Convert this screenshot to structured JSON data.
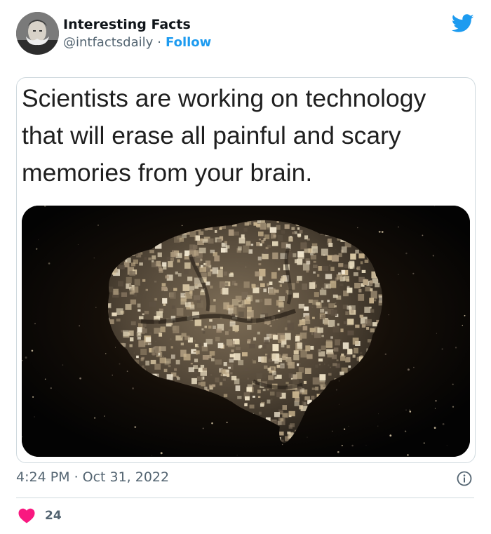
{
  "tweet": {
    "author": {
      "display_name": "Interesting Facts",
      "handle": "@intfactsdaily",
      "separator": "·",
      "follow_label": "Follow",
      "avatar_icon": "portrait-avatar-icon"
    },
    "brand_icon": "twitter-bird-icon",
    "brand_color": "#1d9bf0",
    "media": {
      "caption_lines": [
        "Scientists are working on technology",
        "that will erase all painful and scary",
        "memories from your brain."
      ],
      "image_icon": "glowing-brain-image"
    },
    "time": "4:24 PM",
    "date": "Oct 31, 2022",
    "info_icon": "info-icon",
    "likes": {
      "icon": "heart-icon",
      "color": "#f91880",
      "count": "24"
    }
  }
}
